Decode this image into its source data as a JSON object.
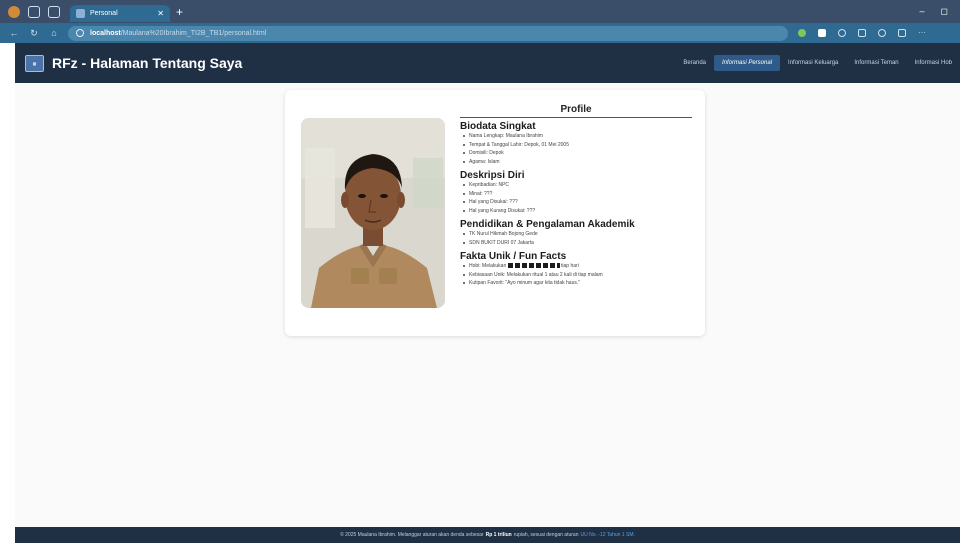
{
  "browser": {
    "tab_title": "Personal",
    "url_host": "localhost",
    "url_path": "/Maulana%20Ibrahim_TI2B_TB1/personal.html"
  },
  "app": {
    "brand": "RFz - Halaman Tentang Saya",
    "nav": [
      "Beranda",
      "Informasi Personal",
      "Informasi Keluarga",
      "Informasi Teman",
      "Informasi Hob"
    ],
    "active_nav": "Informasi Personal"
  },
  "profile": {
    "title": "Profile",
    "biodata_title": "Biodata Singkat",
    "biodata": [
      "Nama Lengkap: Maulana Ibrahim",
      "Tempat & Tanggal Lahir: Depok, 01 Mei 2005",
      "Domisili: Depok",
      "Agama: Islam"
    ],
    "deskripsi_title": "Deskripsi Diri",
    "deskripsi": [
      "Kepribadian: NPC",
      "Minat: ???",
      "Hal yang Disukai: ???",
      "Hal yang Kurang Disukai: ???"
    ],
    "pendidikan_title": "Pendidikan & Pengalaman Akademik",
    "pendidikan": [
      "TK Nurul Hikmah Bojong Gede",
      "SDN BUKIT DURI 07 Jakarta"
    ],
    "fakta_title": "Fakta Unik / Fun Facts",
    "hobi_prefix": "Hobi: Melakukan",
    "hobi_suffix": "tiap hari",
    "fakta_rest": [
      "Kebiasaan Unik: Melakukan ritual 1 atau 2 kali di tiap malam",
      "Kutipan Favorit: \"Ayo minum agar kita tidak haus.\""
    ]
  },
  "footer": {
    "prefix": "© 2025 Maulana Ibrahim. Melanggar aturan akan denda sebesar",
    "amount": "Rp 1 triliun",
    "middle": "rupiah, sesuai dengan aturan",
    "law": "UU No. -12 Tahun 1 SM."
  },
  "colors": {
    "navbar": "#1f2f44",
    "browser_accent": "#2f6a93",
    "active_nav": "#2e5b8a",
    "link": "#5aa0e6"
  }
}
